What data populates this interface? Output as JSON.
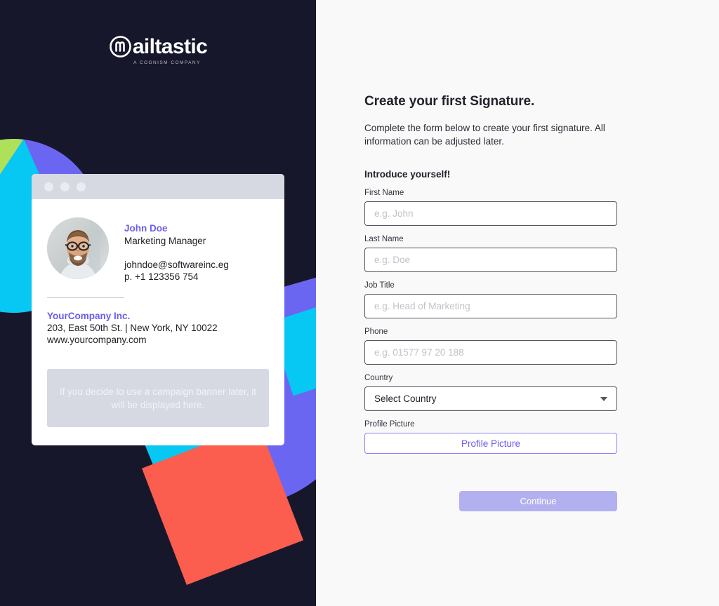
{
  "brand": {
    "mark_icon": "circled-m-logomark",
    "name": "ailtastic",
    "tagline": "A COGNISM COMPANY"
  },
  "colors": {
    "background_dark": "#17172b",
    "panel_light": "#f9f9fa",
    "accent_purple": "#6b5cf0",
    "shape_purple": "#6b66f2",
    "shape_green": "#aee05a",
    "shape_cyan": "#07c8f2",
    "shape_red": "#fb5d4f",
    "button_disabled": "#b3b0f0",
    "placeholder_gray": "#d6d9e2"
  },
  "signature_preview": {
    "window_dots": [
      "dot",
      "dot",
      "dot"
    ],
    "avatar_alt": "profile-photo",
    "name": "John Doe",
    "role": "Marketing Manager",
    "email": "johndoe@softwareinc.eg",
    "phone": "p. +1 123356 754",
    "company": "YourCompany Inc.",
    "address": "203, East 50th St. | New York, NY 10022",
    "website": "www.yourcompany.com",
    "banner_placeholder": "If you decide to use a campaign banner later, it will be displayed here."
  },
  "form": {
    "title": "Create your first Signature.",
    "description": "Complete the form below to create your first signature. All information can be adjusted later.",
    "section_heading": "Introduce yourself!",
    "fields": [
      {
        "label": "First Name",
        "placeholder": "e.g. John",
        "value": ""
      },
      {
        "label": "Last Name",
        "placeholder": "e.g. Doe",
        "value": ""
      },
      {
        "label": "Job Title",
        "placeholder": "e.g. Head of Marketing",
        "value": ""
      },
      {
        "label": "Phone",
        "placeholder": "e.g. 01577 97 20 188",
        "value": ""
      }
    ],
    "country": {
      "label": "Country",
      "selected": "Select Country",
      "chevron_icon": "chevron-down-icon"
    },
    "profile_picture": {
      "label": "Profile Picture",
      "button_label": "Profile Picture"
    },
    "submit_label": "Continue"
  }
}
